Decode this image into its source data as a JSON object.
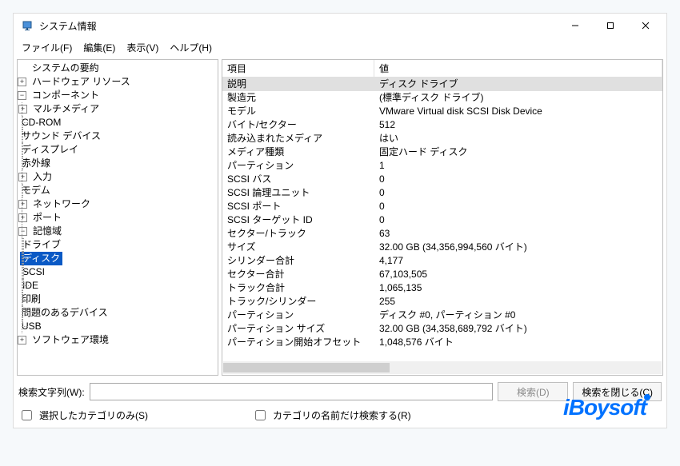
{
  "window": {
    "title": "システム情報"
  },
  "menubar": {
    "file": "ファイル(F)",
    "edit": "編集(E)",
    "view": "表示(V)",
    "help": "ヘルプ(H)"
  },
  "tree": {
    "root": "システムの要約",
    "hardware": "ハードウェア リソース",
    "components": "コンポーネント",
    "multimedia": "マルチメディア",
    "cdrom": "CD-ROM",
    "sound": "サウンド デバイス",
    "display": "ディスプレイ",
    "infrared": "赤外線",
    "input": "入力",
    "modem": "モデム",
    "network": "ネットワーク",
    "port": "ポート",
    "storage": "記憶域",
    "drives": "ドライブ",
    "disks": "ディスク",
    "scsi": "SCSI",
    "ide": "IDE",
    "printing": "印刷",
    "problem": "問題のあるデバイス",
    "usb": "USB",
    "software": "ソフトウェア環境"
  },
  "details": {
    "header_key": "項目",
    "header_val": "値",
    "rows": [
      {
        "key": "説明",
        "val": "ディスク ドライブ",
        "selected": true
      },
      {
        "key": "製造元",
        "val": "(標準ディスク ドライブ)"
      },
      {
        "key": "モデル",
        "val": "VMware Virtual disk SCSI Disk Device"
      },
      {
        "key": "バイト/セクター",
        "val": "512"
      },
      {
        "key": "読み込まれたメディア",
        "val": "はい"
      },
      {
        "key": "メディア種類",
        "val": "固定ハード ディスク"
      },
      {
        "key": "パーティション",
        "val": "1"
      },
      {
        "key": "SCSI バス",
        "val": "0"
      },
      {
        "key": "SCSI 論理ユニット",
        "val": "0"
      },
      {
        "key": "SCSI ポート",
        "val": "0"
      },
      {
        "key": "SCSI ターゲット ID",
        "val": "0"
      },
      {
        "key": "セクター/トラック",
        "val": "63"
      },
      {
        "key": "サイズ",
        "val": "32.00 GB (34,356,994,560 バイト)"
      },
      {
        "key": "シリンダー合計",
        "val": "4,177"
      },
      {
        "key": "セクター合計",
        "val": "67,103,505"
      },
      {
        "key": "トラック合計",
        "val": "1,065,135"
      },
      {
        "key": "トラック/シリンダー",
        "val": "255"
      },
      {
        "key": "パーティション",
        "val": "ディスク #0, パーティション #0"
      },
      {
        "key": "パーティション サイズ",
        "val": "32.00 GB (34,358,689,792 バイト)"
      },
      {
        "key": "パーティション開始オフセット",
        "val": "1,048,576 バイト"
      }
    ]
  },
  "search": {
    "label": "検索文字列(W):",
    "find": "検索(D)",
    "close_find": "検索を閉じる(C)",
    "value": ""
  },
  "checks": {
    "selected_only": "選択したカテゴリのみ(S)",
    "name_only": "カテゴリの名前だけ検索する(R)"
  },
  "watermark": "iBoysoft"
}
